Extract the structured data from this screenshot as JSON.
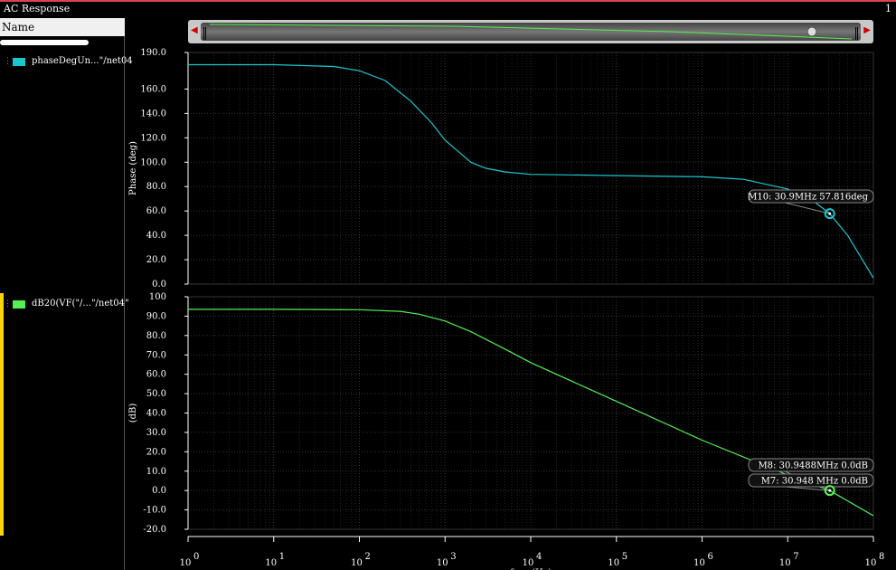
{
  "window": {
    "title": "AC Response",
    "corner_number": "1"
  },
  "sidebar": {
    "header": "Name",
    "traces": [
      {
        "label": "phaseDegUn...\"/net04",
        "color": "#19c7cf"
      },
      {
        "label": "dB20(VF(\"/...\"/net04\"",
        "color": "#52f052"
      }
    ]
  },
  "chart_data": [
    {
      "type": "line",
      "ylabel": "Phase (deg)",
      "x_scale": "log",
      "xlim": [
        1,
        100000000
      ],
      "ylim": [
        0,
        190
      ],
      "yticks": [
        "190.0",
        "160.0",
        "140.0",
        "120.0",
        "100.0",
        "80.0",
        "60.0",
        "40.0",
        "20.0",
        "0.0"
      ],
      "ytick_values": [
        190,
        160,
        140,
        120,
        100,
        80,
        60,
        40,
        20,
        0
      ],
      "grid": true,
      "series": [
        {
          "color": "#19c7cf",
          "x": [
            1,
            10,
            50,
            100,
            200,
            400,
            700,
            1000,
            2000,
            3000,
            5000,
            10000,
            100000,
            1000000,
            3000000,
            10000000,
            20000000,
            30900000,
            50000000,
            100000000
          ],
          "y": [
            180,
            180,
            178.5,
            175,
            167,
            150,
            132,
            118,
            100,
            95,
            92,
            90,
            89,
            88,
            86,
            78,
            68,
            57.8,
            40,
            5
          ]
        }
      ],
      "marker": {
        "label": "M10: 30.9MHz 57.816deg",
        "x": 30900000,
        "y": 57.816,
        "color": "#19c7cf"
      }
    },
    {
      "type": "line",
      "ylabel": "(dB)",
      "x_scale": "log",
      "xlim": [
        1,
        100000000
      ],
      "ylim": [
        -20,
        100
      ],
      "yticks": [
        "100",
        "90.0",
        "80.0",
        "70.0",
        "60.0",
        "50.0",
        "40.0",
        "30.0",
        "20.0",
        "10.0",
        "0.0",
        "-10.0",
        "-20.0"
      ],
      "ytick_values": [
        100,
        90,
        80,
        70,
        60,
        50,
        40,
        30,
        20,
        10,
        0,
        -10,
        -20
      ],
      "xtick_labels": [
        "10",
        "10",
        "10",
        "10",
        "10",
        "10",
        "10",
        "10",
        "10"
      ],
      "xtick_exponents": [
        "0",
        "1",
        "2",
        "3",
        "4",
        "5",
        "6",
        "7",
        "8"
      ],
      "xlabel": "freq (Hz)",
      "grid": true,
      "series": [
        {
          "color": "#52f052",
          "x": [
            1,
            10,
            100,
            300,
            500,
            1000,
            2000,
            5000,
            10000,
            100000,
            1000000,
            10000000,
            30948800,
            100000000
          ],
          "y": [
            93.5,
            93.5,
            93.3,
            92.5,
            91,
            87.5,
            82,
            73,
            66,
            46,
            26,
            8,
            0,
            -13
          ]
        }
      ],
      "markers": [
        {
          "label": "M8: 30.9488MHz 0.0dB",
          "x": 30948800,
          "y": 0.0,
          "color": "#52f052"
        },
        {
          "label": "M7: 30.948 MHz 0.0dB",
          "x": 30948000,
          "y": 0.0,
          "color": "#52f052"
        }
      ]
    }
  ]
}
